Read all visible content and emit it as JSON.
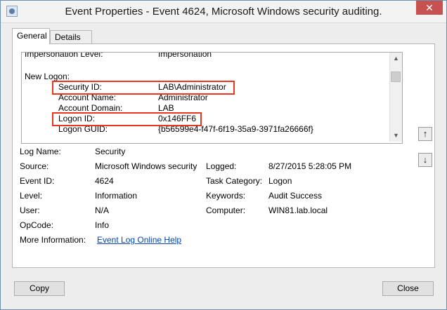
{
  "window": {
    "title": "Event Properties - Event 4624, Microsoft Windows security auditing.",
    "close_glyph": "✕"
  },
  "tabs": [
    {
      "label": "General"
    },
    {
      "label": "Details"
    }
  ],
  "description": {
    "lines": [
      {
        "label": "Impersonation Level:",
        "value": "Impersonation"
      },
      {
        "label": "",
        "value": ""
      },
      {
        "label": "New Logon:",
        "value": ""
      },
      {
        "label": "Security ID:",
        "value": "LAB\\Administrator"
      },
      {
        "label": "Account Name:",
        "value": "Administrator"
      },
      {
        "label": "Account Domain:",
        "value": "LAB"
      },
      {
        "label": "Logon ID:",
        "value": "0x146FF6"
      },
      {
        "label": "Logon GUID:",
        "value": "{b56599e4-f47f-6f19-35a9-3971fa26666f}"
      }
    ]
  },
  "fields": {
    "log_name_label": "Log Name:",
    "log_name": "Security",
    "source_label": "Source:",
    "source": "Microsoft Windows security",
    "logged_label": "Logged:",
    "logged": "8/27/2015 5:28:05 PM",
    "event_id_label": "Event ID:",
    "event_id": "4624",
    "task_category_label": "Task Category:",
    "task_category": "Logon",
    "level_label": "Level:",
    "level": "Information",
    "keywords_label": "Keywords:",
    "keywords": "Audit Success",
    "user_label": "User:",
    "user": "N/A",
    "computer_label": "Computer:",
    "computer": "WIN81.lab.local",
    "opcode_label": "OpCode:",
    "opcode": "Info",
    "more_info_label": "More Information:",
    "more_info_link": "Event Log Online Help"
  },
  "buttons": {
    "copy": "Copy",
    "close": "Close"
  },
  "icons": {
    "nav_up": "↑",
    "nav_down": "↓",
    "scroll_up": "▲",
    "scroll_down": "▼"
  },
  "colors": {
    "highlight": "#e8371f",
    "link": "#0645ad"
  }
}
